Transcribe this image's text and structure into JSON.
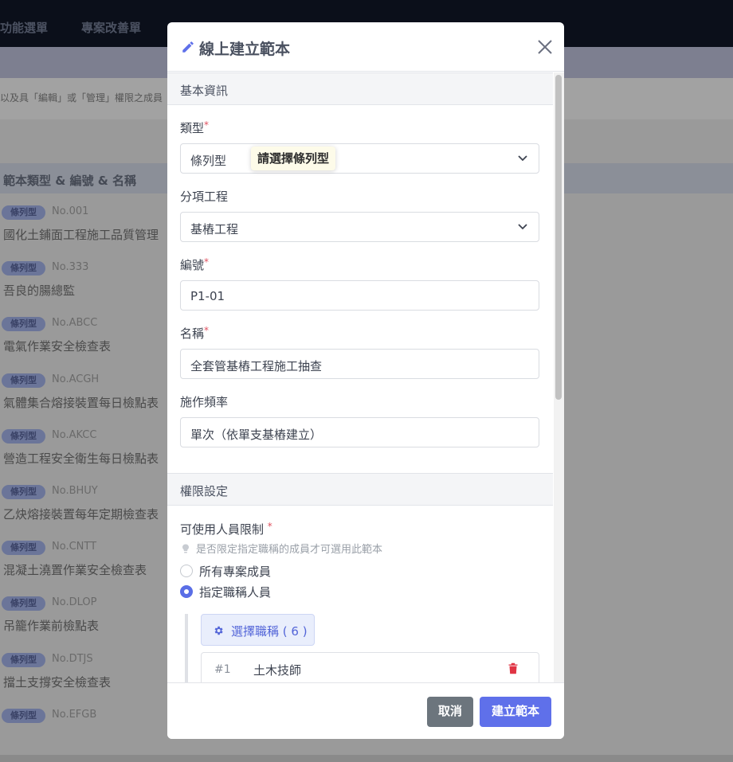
{
  "background": {
    "nav": [
      "功能選單",
      "專案改善單"
    ],
    "notice": "以及具「編輯」或「管理」權限之成員",
    "table_header": "範本類型 & 編號 & 名稱",
    "rows": [
      {
        "badge": "條列型",
        "no": "No.001",
        "name": "國化土鋪面工程施工品質管理"
      },
      {
        "badge": "條列型",
        "no": "No.333",
        "name": "吾良的腸總監"
      },
      {
        "badge": "條列型",
        "no": "No.ABCC",
        "name": "電氣作業安全檢查表"
      },
      {
        "badge": "條列型",
        "no": "No.ACGH",
        "name": "氣體集合熔接裝置每日檢點表"
      },
      {
        "badge": "條列型",
        "no": "No.AKCC",
        "name": "營造工程安全衛生每日檢點表"
      },
      {
        "badge": "條列型",
        "no": "No.BHUY",
        "name": "乙炔熔接裝置每年定期檢查表"
      },
      {
        "badge": "條列型",
        "no": "No.CNTT",
        "name": "混凝土澆置作業安全檢查表"
      },
      {
        "badge": "條列型",
        "no": "No.DLOP",
        "name": "吊籠作業前檢點表"
      },
      {
        "badge": "條列型",
        "no": "No.DTJS",
        "name": "擋土支撐安全檢查表"
      },
      {
        "badge": "條列型",
        "no": "No.EFGB",
        "name": ""
      }
    ]
  },
  "modal": {
    "title": "線上建立範本",
    "sections": {
      "basic": "基本資訊",
      "permission": "權限設定"
    },
    "fields": {
      "type": {
        "label": "類型",
        "value": "條列型",
        "tooltip": "請選擇條列型"
      },
      "subitem": {
        "label": "分項工程",
        "value": "基樁工程"
      },
      "code": {
        "label": "編號",
        "value": "P1-01"
      },
      "name": {
        "label": "名稱",
        "value": "全套管基樁工程施工抽查"
      },
      "frequency": {
        "label": "施作頻率",
        "value": "單次（依單支基樁建立）"
      }
    },
    "required_mark": "*",
    "permission": {
      "label": "可使用人員限制",
      "hint": "是否限定指定職稱的成員才可選用此範本",
      "options": [
        "所有專案成員",
        "指定職稱人員"
      ],
      "selected_index": 1,
      "select_button": "選擇職稱 ( 6 )",
      "items": [
        {
          "index": "#1",
          "name": "土木技師"
        }
      ]
    },
    "footer": {
      "cancel": "取消",
      "create": "建立範本"
    }
  },
  "colors": {
    "primary": "#5f70ea",
    "cancel": "#6c757d",
    "danger": "#e03444",
    "required": "#e05260"
  }
}
